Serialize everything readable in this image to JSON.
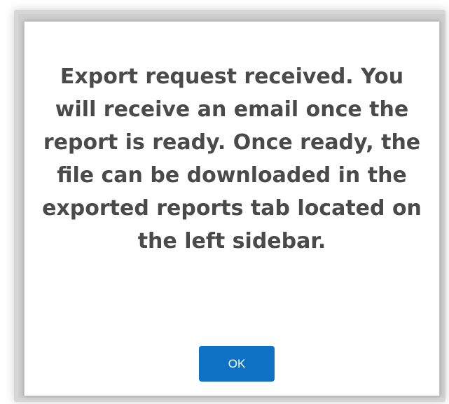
{
  "dialog": {
    "message": "Export request received. You will receive an email once the report is ready. Once ready, the file can be downloaded in the exported reports tab located on the left sidebar.",
    "ok_label": "OK"
  },
  "colors": {
    "button": "#0e71c4",
    "text": "#4a4a4a"
  }
}
